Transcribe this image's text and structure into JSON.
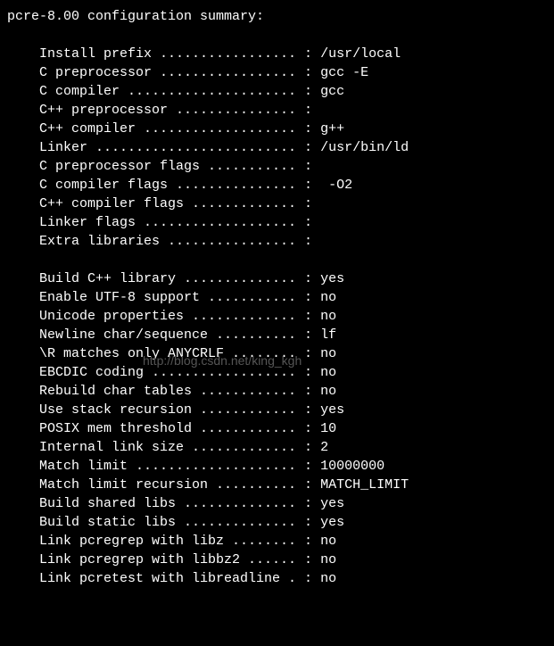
{
  "header": "pcre-8.00 configuration summary:",
  "watermark": "http://blog.csdn.net/king_kgh",
  "section1": [
    {
      "label": "Install prefix",
      "value": "/usr/local"
    },
    {
      "label": "C preprocessor",
      "value": "gcc -E"
    },
    {
      "label": "C compiler",
      "value": "gcc"
    },
    {
      "label": "C++ preprocessor",
      "value": ""
    },
    {
      "label": "C++ compiler",
      "value": "g++"
    },
    {
      "label": "Linker",
      "value": "/usr/bin/ld"
    },
    {
      "label": "C preprocessor flags",
      "value": ""
    },
    {
      "label": "C compiler flags",
      "value": " -O2"
    },
    {
      "label": "C++ compiler flags",
      "value": ""
    },
    {
      "label": "Linker flags",
      "value": ""
    },
    {
      "label": "Extra libraries",
      "value": ""
    }
  ],
  "section2": [
    {
      "label": "Build C++ library",
      "value": "yes"
    },
    {
      "label": "Enable UTF-8 support",
      "value": "no"
    },
    {
      "label": "Unicode properties",
      "value": "no"
    },
    {
      "label": "Newline char/sequence",
      "value": "lf"
    },
    {
      "label": "\\R matches only ANYCRLF",
      "value": "no"
    },
    {
      "label": "EBCDIC coding",
      "value": "no"
    },
    {
      "label": "Rebuild char tables",
      "value": "no"
    },
    {
      "label": "Use stack recursion",
      "value": "yes"
    },
    {
      "label": "POSIX mem threshold",
      "value": "10"
    },
    {
      "label": "Internal link size",
      "value": "2"
    },
    {
      "label": "Match limit",
      "value": "10000000"
    },
    {
      "label": "Match limit recursion",
      "value": "MATCH_LIMIT"
    },
    {
      "label": "Build shared libs",
      "value": "yes"
    },
    {
      "label": "Build static libs",
      "value": "yes"
    },
    {
      "label": "Link pcregrep with libz",
      "value": "no"
    },
    {
      "label": "Link pcregrep with libbz2",
      "value": "no"
    },
    {
      "label": "Link pcretest with libreadline",
      "value": "no"
    }
  ],
  "layout": {
    "labelWidth": 32
  }
}
